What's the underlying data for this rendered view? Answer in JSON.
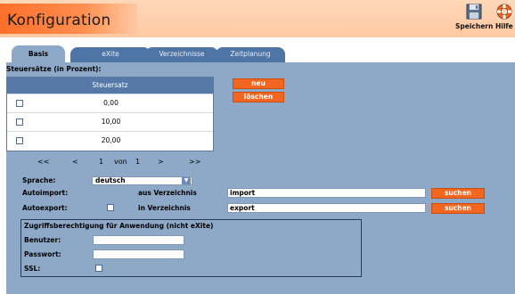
{
  "window": {
    "title": "Konfiguration"
  },
  "toolbar": {
    "save_label": "Speichern",
    "help_label": "Hilfe"
  },
  "tabs": [
    {
      "label": "Basis",
      "active": true
    },
    {
      "label": "eXite",
      "active": false
    },
    {
      "label": "Verzeichnisse",
      "active": false
    },
    {
      "label": "Zeitplanung",
      "active": false
    }
  ],
  "tax": {
    "section_label": "Steuersätze (in Prozent):",
    "column_header": "Steuersatz",
    "rows": [
      {
        "value": "0,00",
        "checked": false
      },
      {
        "value": "10,00",
        "checked": false
      },
      {
        "value": "20,00",
        "checked": false
      }
    ],
    "new_label": "neu",
    "delete_label": "löschen"
  },
  "pager": {
    "first": "<<",
    "prev": "<",
    "page": "1",
    "of": "von",
    "total": "1",
    "next": ">",
    "last": ">>"
  },
  "language": {
    "label": "Sprache:",
    "value": "deutsch"
  },
  "autoimport": {
    "label": "Autoimport:",
    "source_label": "aus Verzeichnis",
    "value": "import",
    "search_label": "suchen"
  },
  "autoexport": {
    "label": "Autoexport:",
    "checked": false,
    "target_label": "in Verzeichnis",
    "value": "export",
    "search_label": "suchen"
  },
  "access": {
    "title": "Zugriffsberechtigung für Anwendung (nicht eXite)",
    "user_label": "Benutzer:",
    "user_value": "",
    "password_label": "Passwort:",
    "password_value": "",
    "ssl_label": "SSL:",
    "ssl_checked": false
  },
  "colors": {
    "accent": "#f2661f",
    "panel": "#8ea8c8",
    "tab": "#4f74a6",
    "grid_header": "#5679a8"
  },
  "icons": [
    "floppy-disk-icon",
    "lifebuoy-icon",
    "select-arrow-icon"
  ]
}
